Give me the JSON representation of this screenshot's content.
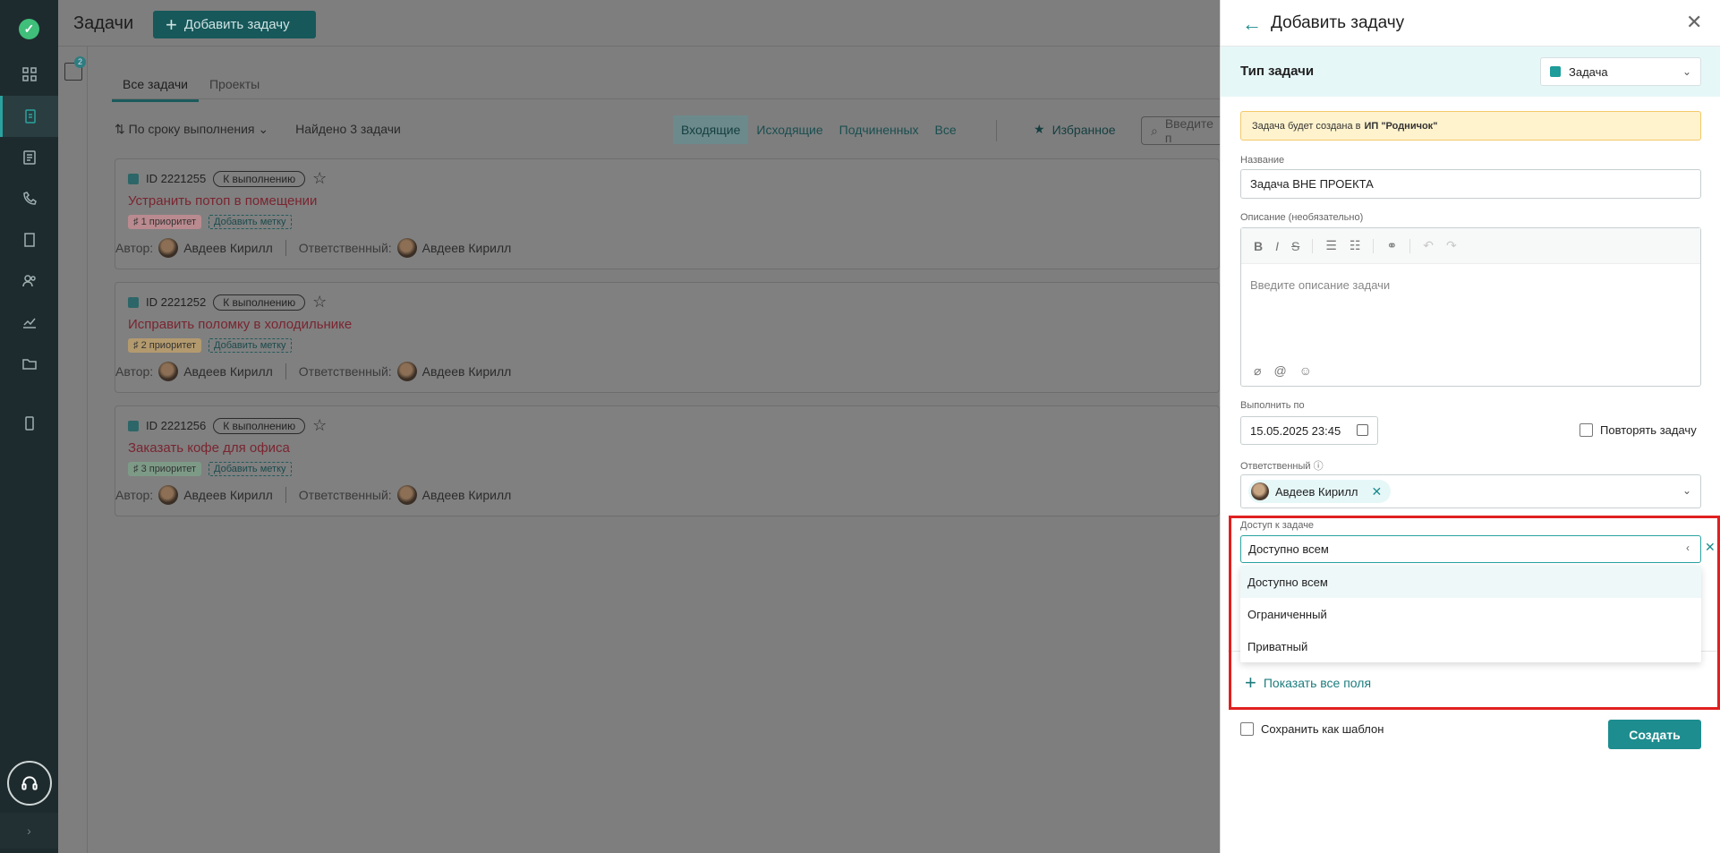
{
  "main": {
    "title": "Задачи",
    "add_button": "Добавить задачу",
    "filter_badge": "2",
    "tabs": [
      "Все задачи",
      "Проекты"
    ],
    "sort_label": "По сроку выполнения",
    "found": "Найдено 3 задачи",
    "segments": [
      "Входящие",
      "Исходящие",
      "Подчиненных",
      "Все"
    ],
    "favorites": "Избранное",
    "search_placeholder": "Введите п",
    "author_label": "Автор:",
    "responsible_label": "Ответственный:",
    "add_tag": "Добавить метку",
    "tasks": [
      {
        "id": "ID 2221255",
        "status": "К выполнению",
        "name": "Устранить потоп в помещении",
        "priority": "1 приоритет",
        "priority_color": "#b98a8f",
        "author": "Авдеев Кирилл",
        "responsible": "Авдеев Кирилл"
      },
      {
        "id": "ID 2221252",
        "status": "К выполнению",
        "name": "Исправить поломку в холодильнике",
        "priority": "2 приоритет",
        "priority_color": "#b39a6e",
        "author": "Авдеев Кирилл",
        "responsible": "Авдеев Кирилл"
      },
      {
        "id": "ID 2221256",
        "status": "К выполнению",
        "name": "Заказать кофе для офиса",
        "priority": "3 приоритет",
        "priority_color": "#7d9a87",
        "author": "Авдеев Кирилл",
        "responsible": "Авдеев Кирилл"
      }
    ]
  },
  "panel": {
    "title": "Добавить задачу",
    "type_label": "Тип задачи",
    "type_value": "Задача",
    "notice_prefix": "Задача будет создана в",
    "notice_org": "ИП \"Родничок\"",
    "name_label": "Название",
    "name_value": "Задача ВНЕ ПРОЕКТА",
    "desc_label": "Описание (необязательно)",
    "desc_placeholder": "Введите описание задачи",
    "due_label": "Выполнить по",
    "due_value": "15.05.2025 23:45",
    "repeat_label": "Повторять задачу",
    "responsible_label": "Ответственный",
    "responsible_value": "Авдеев Кирилл",
    "access_label": "Доступ к задаче",
    "access_value": "Доступно всем",
    "access_options": [
      "Доступно всем",
      "Ограниченный",
      "Приватный"
    ],
    "show_all": "Показать все поля",
    "save_template": "Сохранить как шаблон",
    "create": "Создать"
  },
  "colors": {
    "accent": "#1e8d8f",
    "highlight": "#e02020",
    "notice_bg": "#fff3cd"
  }
}
